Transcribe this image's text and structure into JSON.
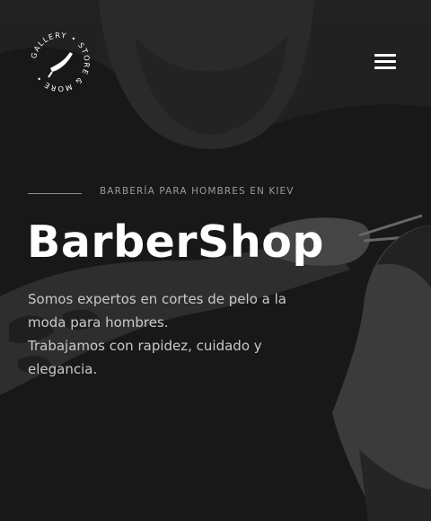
{
  "header": {
    "logo": {
      "ring_text": "GALLERY • STORE & MORE •"
    },
    "menu_icon": "hamburger-menu-icon"
  },
  "hero": {
    "subtitle": "BARBERÍA PARA HOMBRES EN KIEV",
    "title": "BarberShop",
    "description_lines": [
      "Somos expertos en cortes de pelo a la",
      "moda para hombres.",
      "Trabajamos con rapidez, cuidado y",
      "elegancia."
    ]
  },
  "colors": {
    "background": "#232323",
    "title": "#ffffff",
    "subtitle": "#9a9a9a",
    "body_text": "#c9c9c9"
  }
}
